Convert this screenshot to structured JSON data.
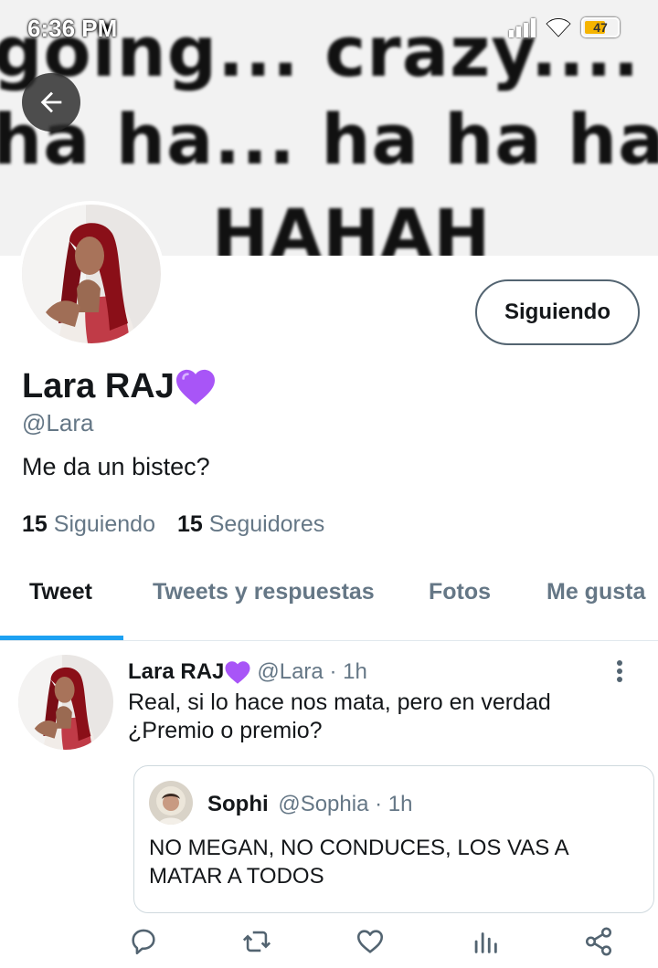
{
  "status_bar": {
    "time": "6:36 PM",
    "battery_level": "47"
  },
  "banner": {
    "line1": "going... crazy.... ha",
    "line2": "ha ha... ha ha ha HA",
    "line3": "HAHAH"
  },
  "profile": {
    "display_name": "Lara RAJ",
    "handle": "@Lara",
    "bio": "Me da un bistec?",
    "follow_button": "Siguiendo",
    "following_count": "15",
    "following_label": "Siguiendo",
    "followers_count": "15",
    "followers_label": "Seguidores"
  },
  "tabs": [
    {
      "label": "Tweet",
      "active": true
    },
    {
      "label": "Tweets y respuestas",
      "active": false
    },
    {
      "label": "Fotos",
      "active": false
    },
    {
      "label": "Me gusta",
      "active": false
    }
  ],
  "tweet": {
    "author_name": "Lara RAJ",
    "author_meta": "@Lara · 1h",
    "text_line1": "Real, si lo hace nos mata, pero en verdad",
    "text_line2": "¿Premio o premio?",
    "quote": {
      "author_name": "Sophi",
      "author_meta": "@Sophia · 1h",
      "text_line1": "NO MEGAN, NO CONDUCES, LOS VAS A",
      "text_line2": "MATAR A TODOS"
    }
  },
  "colors": {
    "accent": "#1da1f2",
    "heart": "#a855f7",
    "secondary_text": "#657786"
  },
  "icons": {
    "back": "arrow-left-icon",
    "more": "more-vertical-icon",
    "reply": "reply-icon",
    "retweet": "retweet-icon",
    "like": "like-icon",
    "analytics": "analytics-icon",
    "share": "share-icon"
  }
}
